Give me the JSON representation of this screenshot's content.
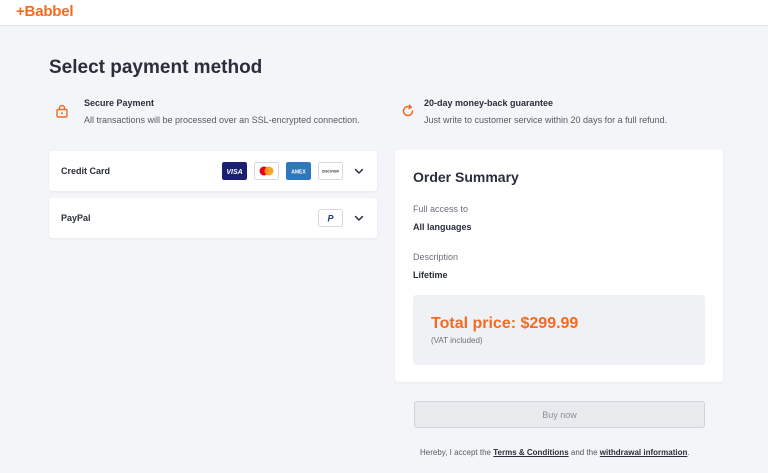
{
  "header": {
    "logo": "+Babbel"
  },
  "page_title": "Select payment method",
  "features": [
    {
      "icon": "lock-icon",
      "title": "Secure Payment",
      "description": "All transactions will be processed over an SSL-encrypted connection."
    },
    {
      "icon": "refresh-icon",
      "title": "20-day money-back guarantee",
      "description": "Just write to customer service within 20 days for a full refund."
    }
  ],
  "payment_methods": [
    {
      "label": "Credit Card",
      "brands": [
        "VISA",
        "Mastercard",
        "AMEX",
        "DISCOVER"
      ]
    },
    {
      "label": "PayPal",
      "brands": [
        "PayPal"
      ]
    }
  ],
  "summary": {
    "title": "Order Summary",
    "access_label": "Full access to",
    "access_value": "All languages",
    "description_label": "Description",
    "description_value": "Lifetime",
    "total": "Total price: $299.99",
    "vat_note": "(VAT included)"
  },
  "buy_button": "Buy now",
  "legal": {
    "prefix": "Hereby, I accept the ",
    "terms_link": "Terms & Conditions",
    "middle": " and the ",
    "withdrawal_link": "withdrawal information",
    "suffix": "."
  },
  "colors": {
    "accent": "#f26b21",
    "visa": "#1a1f71",
    "amex": "#2e77bc",
    "background": "#f4f5f8"
  }
}
